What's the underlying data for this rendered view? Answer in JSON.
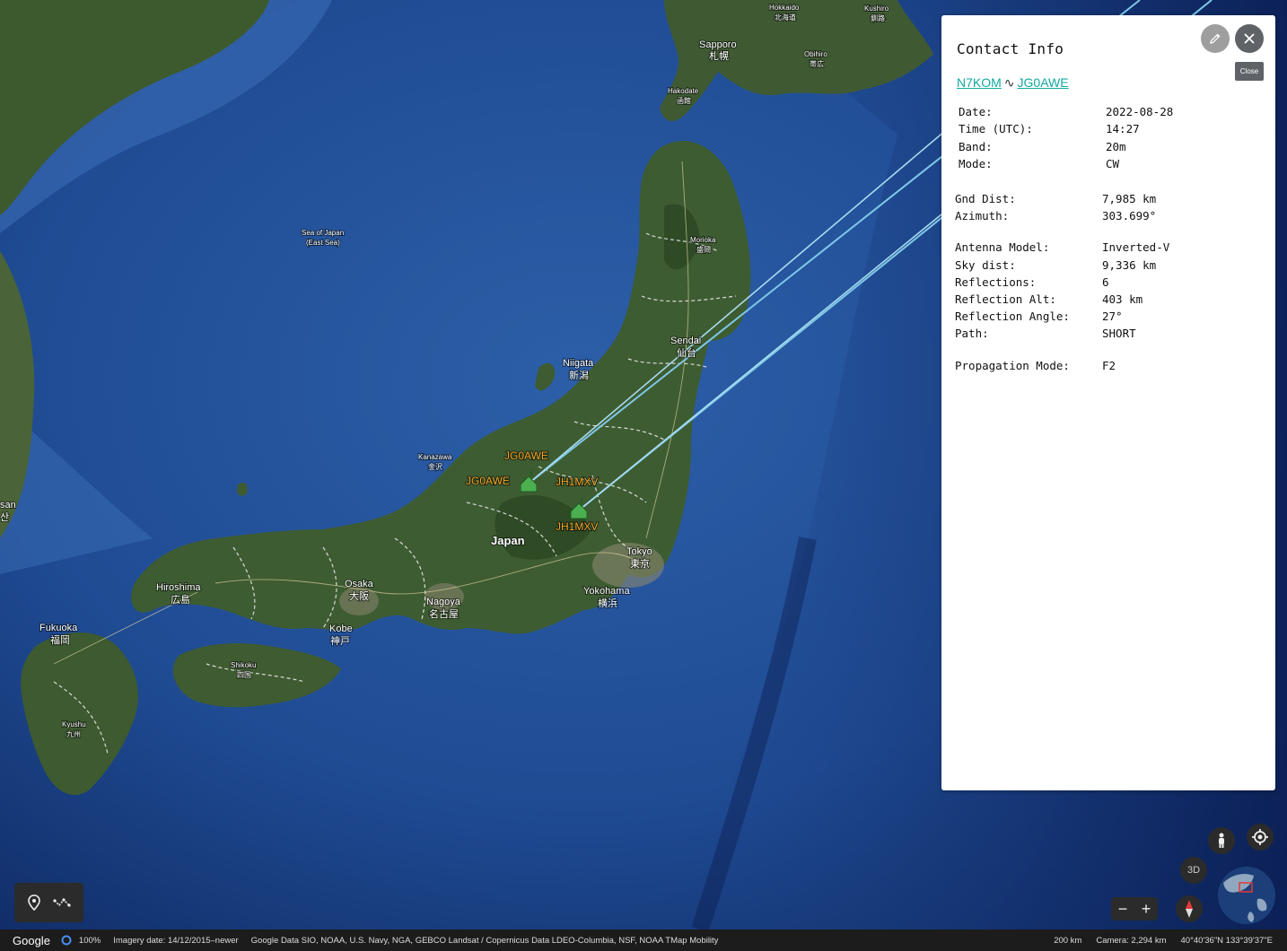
{
  "map": {
    "labels": {
      "hokkaido": "Hokkaido",
      "hokkaido_jp": "北海道",
      "kushiro": "Kushiro",
      "kushiro_jp": "釧路",
      "sapporo": "Sapporo",
      "sapporo_jp": "札幌",
      "obihiro": "Obihiro",
      "obihiro_jp": "帯広",
      "hakodate": "Hakodate",
      "hakodate_jp": "函館",
      "sea_of_japan": "Sea of Japan",
      "east_sea": "(East Sea)",
      "morioka": "Morioka",
      "morioka_jp": "盛岡",
      "sendai": "Sendai",
      "sendai_jp": "仙台",
      "niigata": "Niigata",
      "niigata_jp": "新潟",
      "kanazawa": "Kanazawa",
      "kanazawa_jp": "金沢",
      "japan": "Japan",
      "tokyo": "Tokyo",
      "tokyo_jp": "東京",
      "yokohama": "Yokohama",
      "yokohama_jp": "横浜",
      "nagoya": "Nagoya",
      "nagoya_jp": "名古屋",
      "osaka": "Osaka",
      "osaka_jp": "大阪",
      "kobe": "Kobe",
      "kobe_jp": "神戸",
      "hiroshima": "Hiroshima",
      "hiroshima_jp": "広島",
      "shikoku": "Shikoku",
      "shikoku_jp": "四国",
      "fukuoka": "Fukuoka",
      "fukuoka_jp": "福岡",
      "kyushu": "Kyushu",
      "kyushu_jp": "九州",
      "busan_fragment": "san",
      "busan_jp_fragment": "산"
    },
    "placemarks": {
      "jg0awe_top": "JG0AWE",
      "jg0awe_left": "JG0AWE",
      "jh1mxv_top": "JH1MXV",
      "jh1mxv_bottom": "JH1MXV"
    },
    "colors": {
      "path_line": "#7fc8e8",
      "placemark_label": "#f6a623",
      "placemark_icon": "#4caf50"
    }
  },
  "panel": {
    "title": "Contact Info",
    "close_tooltip": "Close",
    "call_from": "N7KOM",
    "call_separator": "∿",
    "call_to": "JG0AWE",
    "rows": [
      {
        "key": "Date:",
        "value": "2022-08-28"
      },
      {
        "key": "Time (UTC):",
        "value": "14:27"
      },
      {
        "key": "Band:",
        "value": "20m"
      },
      {
        "key": "Mode:",
        "value": "CW"
      },
      {
        "key": "Gnd Dist:",
        "value": "7,985 km"
      },
      {
        "key": "Azimuth:",
        "value": "303.699°"
      },
      {
        "key": "Antenna Model:",
        "value": "Inverted-V"
      },
      {
        "key": "Sky dist:",
        "value": "9,336 km"
      },
      {
        "key": "Reflections:",
        "value": "6"
      },
      {
        "key": "Reflection Alt:",
        "value": "403 km"
      },
      {
        "key": "Reflection Angle:",
        "value": "27°"
      },
      {
        "key": "Path:",
        "value": "SHORT"
      },
      {
        "key": "Propagation Mode:",
        "value": "F2"
      }
    ]
  },
  "controls": {
    "btn_3d": "3D",
    "zoom_out": "−",
    "zoom_in": "+"
  },
  "footer": {
    "brand": "Google",
    "zoom_pct": "100%",
    "imagery_date": "Imagery date: 14/12/2015–newer",
    "credits": "Google   Data SIO, NOAA, U.S. Navy, NGA, GEBCO   Landsat / Copernicus   Data LDEO-Columbia, NSF, NOAA   TMap Mobility",
    "scale": "200 km",
    "camera": "Camera: 2,294 km",
    "coords": "40°40'36\"N 133°39'37\"E"
  }
}
